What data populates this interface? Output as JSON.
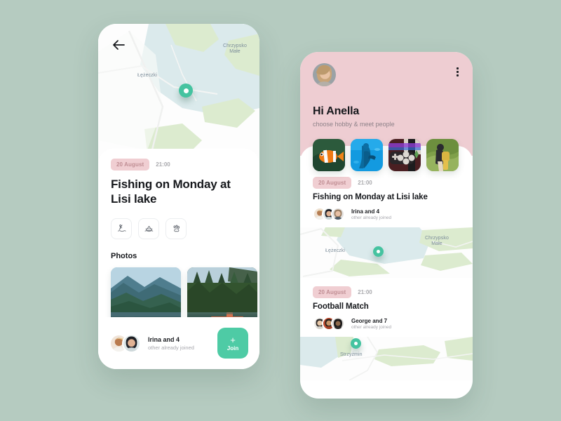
{
  "theme": {
    "background": "#b5cbc0",
    "accent_green": "#4ecba5",
    "pink_header": "#eecdd2",
    "badge_pink": "#f0ced2",
    "badge_text": "#c08e94",
    "map_water": "#dbeaec",
    "map_land": "#dcebcf"
  },
  "detail_screen": {
    "back_icon": "arrow-left-icon",
    "map": {
      "labels": [
        {
          "text": "Łężeczki"
        },
        {
          "text": "Chrzypsko\nMałe"
        }
      ],
      "pin": "location-pin"
    },
    "badge": "20 August",
    "time": "21:00",
    "title": "Fishing on Monday at Lisi lake",
    "categories": [
      {
        "icon": "fishing-icon",
        "label": "Fishing"
      },
      {
        "icon": "boat-icon",
        "label": "Boating"
      },
      {
        "icon": "paw-icon",
        "label": "Pets"
      }
    ],
    "photos_heading": "Photos",
    "photos": [
      {
        "alt": "mountain-lake-photo"
      },
      {
        "alt": "forest-dock-photo"
      }
    ],
    "joined": {
      "main": "Irina and 4",
      "sub": "other already joined",
      "avatars": [
        "avatar-1",
        "avatar-2"
      ]
    },
    "join_button": {
      "plus": "+",
      "label": "Join"
    }
  },
  "home_screen": {
    "avatar": "profile-avatar",
    "menu_icon": "kebab-menu-icon",
    "greeting": "Hi Anella",
    "subtitle": "choose hobby & meet people",
    "hobbies": [
      {
        "name": "aquarium-fish-hobby"
      },
      {
        "name": "scuba-diving-hobby"
      },
      {
        "name": "gaming-hobby"
      },
      {
        "name": "hiking-hobby"
      }
    ],
    "events": [
      {
        "badge": "20 August",
        "time": "21:00",
        "title": "Fishing on Monday at Lisi lake",
        "joined_main": "Irina and 4",
        "joined_sub": "other already joined",
        "map_labels": [
          {
            "text": "Łężeczki"
          },
          {
            "text": "Chrzypsko\nMałe"
          }
        ]
      },
      {
        "badge": "20 August",
        "time": "21:00",
        "title": "Football Match",
        "joined_main": "George and 7",
        "joined_sub": "other already joined",
        "map_labels": [
          {
            "text": "Strzyżmin"
          }
        ]
      }
    ]
  }
}
